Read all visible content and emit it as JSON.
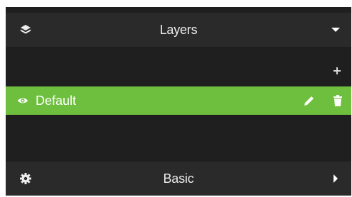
{
  "layers_panel": {
    "title": "Layers",
    "header_icon": "layers-icon",
    "toggle_icon": "caret-down-icon",
    "add_icon": "plus-icon",
    "items": [
      {
        "label": "Default",
        "selected": true,
        "visibility_icon": "eye-icon",
        "edit_icon": "pencil-icon",
        "delete_icon": "trash-icon"
      }
    ]
  },
  "basic_panel": {
    "title": "Basic",
    "header_icon": "gear-icon",
    "toggle_icon": "caret-right-icon"
  },
  "colors": {
    "panel_bg": "#1f1f1f",
    "header_bg": "#2a2a2a",
    "selected_row": "#6ebf3d",
    "text": "#ececec"
  }
}
